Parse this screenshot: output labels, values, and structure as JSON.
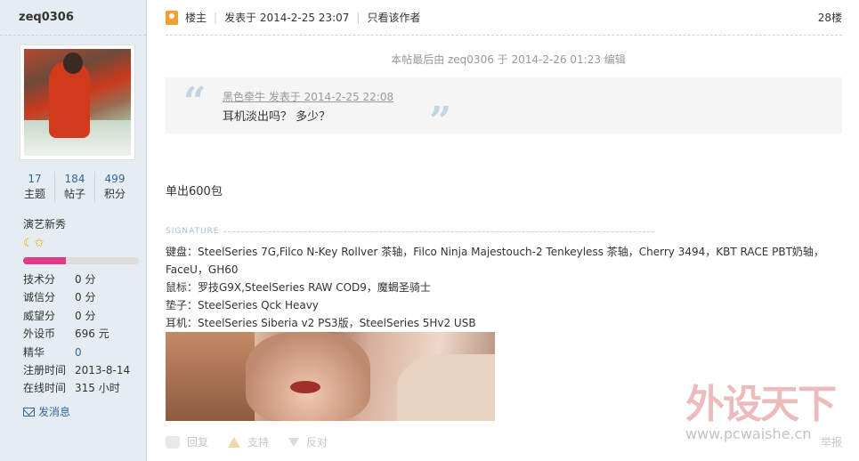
{
  "author": {
    "username": "zeq0306",
    "stats": [
      {
        "value": "17",
        "label": "主题"
      },
      {
        "value": "184",
        "label": "帖子"
      },
      {
        "value": "499",
        "label": "积分"
      }
    ],
    "rank_title": "演艺新秀",
    "rank_stars": "☾✩",
    "rank_progress_percent": 37,
    "profile": [
      {
        "key": "技术分",
        "value": "0 分"
      },
      {
        "key": "诚信分",
        "value": "0 分"
      },
      {
        "key": "威望分",
        "value": "0 分"
      },
      {
        "key": "外设币",
        "value": "696 元"
      },
      {
        "key": "精华",
        "value": "0"
      },
      {
        "key": "注册时间",
        "value": "2013-8-14"
      },
      {
        "key": "在线时间",
        "value": "315 小时"
      }
    ],
    "send_message_label": "发消息"
  },
  "post": {
    "role_label": "楼主",
    "posted_at": "发表于 2014-2-25 23:07",
    "view_author_only": "只看该作者",
    "floor": "28楼",
    "edited_note": "本帖最后由 zeq0306 于 2014-2-26 01:23 编辑",
    "quote": {
      "author_line": "黑色牵牛 发表于 2014-2-25 22:08",
      "text": "耳机淡出吗？ 多少？"
    },
    "body": "单出600包",
    "signature_label": "SIGNATURE",
    "signature_lines": [
      "键盘：SteelSeries 7G,Filco N-Key Rollver 茶轴，Filco Ninja Majestouch-2 Tenkeyless 茶轴，Cherry 3494，KBT RACE PBT奶轴，",
      "FaceU，GH60",
      "鼠标：罗技G9X,SteelSeries RAW COD9，魔蝎圣骑士",
      "垫子：SteelSeries Qck Heavy",
      "耳机：SteelSeries Siberia v2 PS3版，SteelSeries 5Hv2 USB"
    ]
  },
  "actions": {
    "reply": "回复",
    "support": "支持",
    "oppose": "反对",
    "report": "举报"
  },
  "watermark": {
    "brand": "外设天下",
    "url": "www.pcwaishe.cn"
  }
}
